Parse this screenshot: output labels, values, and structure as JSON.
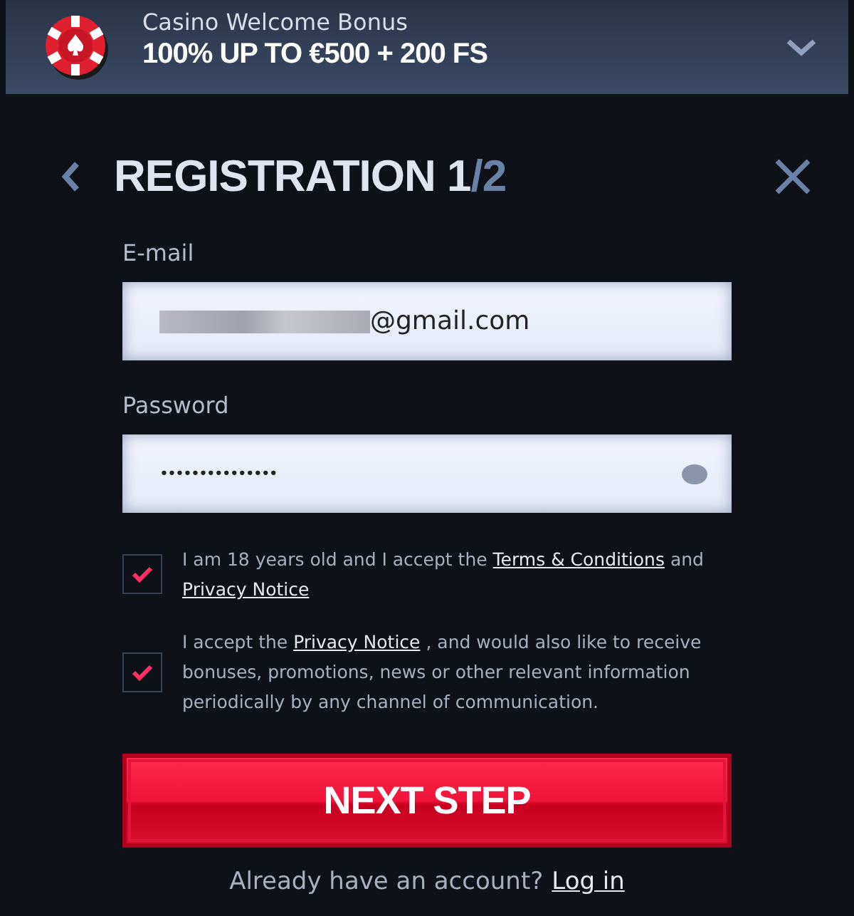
{
  "banner": {
    "subtitle": "Casino Welcome Bonus",
    "title": "100% UP TO €500 + 200 FS",
    "expanded": false
  },
  "heading": {
    "title": "REGISTRATION 1",
    "step_total": "/2"
  },
  "fields": [
    {
      "kind": "email",
      "label": "E-mail",
      "value": "@gmail.com",
      "redacted": true
    },
    {
      "kind": "password",
      "label": "Password",
      "value": "•••••••••••••••"
    }
  ],
  "consents": [
    {
      "checked": true,
      "parts": [
        {
          "kind": "text",
          "text": "I am 18 years old and I accept the "
        },
        {
          "kind": "link",
          "text": "Terms & Conditions"
        },
        {
          "kind": "text",
          "text": " and "
        },
        {
          "kind": "link",
          "text": "Privacy Notice"
        }
      ]
    },
    {
      "checked": true,
      "parts": [
        {
          "kind": "text",
          "text": "I accept the "
        },
        {
          "kind": "link",
          "text": "Privacy Notice"
        },
        {
          "kind": "text",
          "text": " , and would also like to receive bonuses, promotions, news or other relevant information periodically by any channel of communication."
        }
      ]
    }
  ],
  "submit": "NEXT STEP",
  "footer": {
    "text": "Already have an account?",
    "link": "Log in"
  }
}
